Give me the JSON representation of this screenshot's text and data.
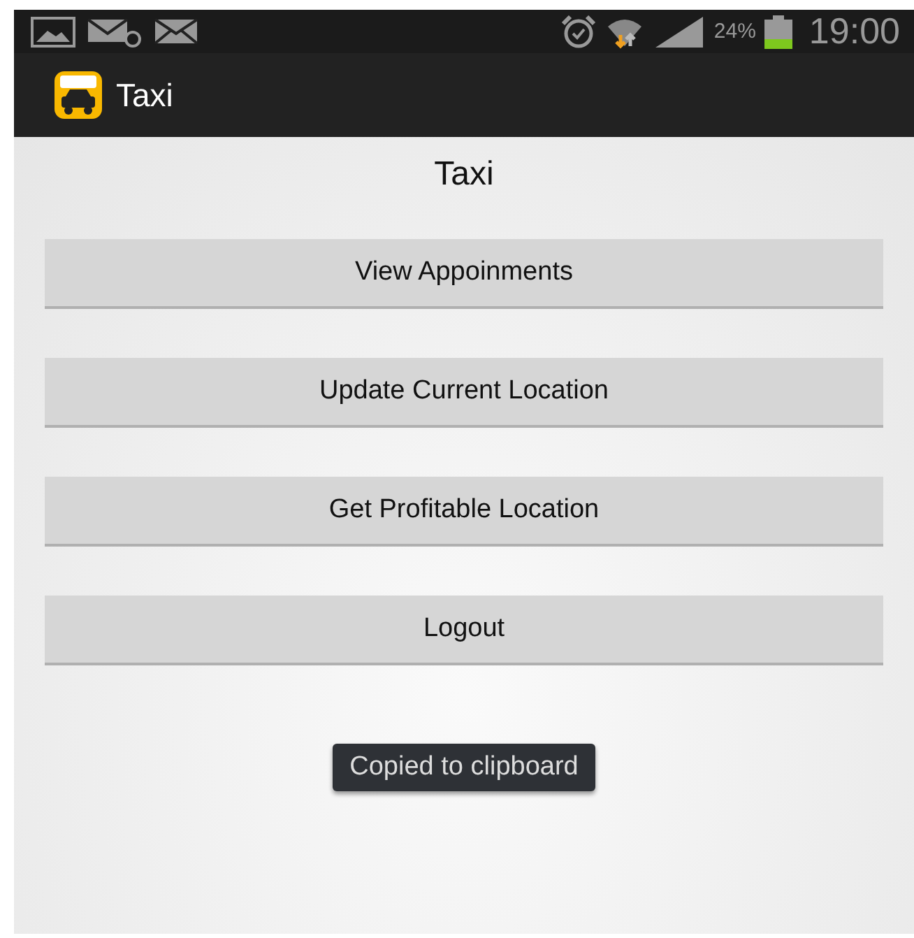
{
  "status_bar": {
    "battery": "24%",
    "time": "19:00"
  },
  "action_bar": {
    "title": "Taxi"
  },
  "heading": "Taxi",
  "buttons": [
    "View Appoinments",
    "Update Current Location",
    "Get Profitable Location",
    "Logout"
  ],
  "toast": "Copied to clipboard"
}
